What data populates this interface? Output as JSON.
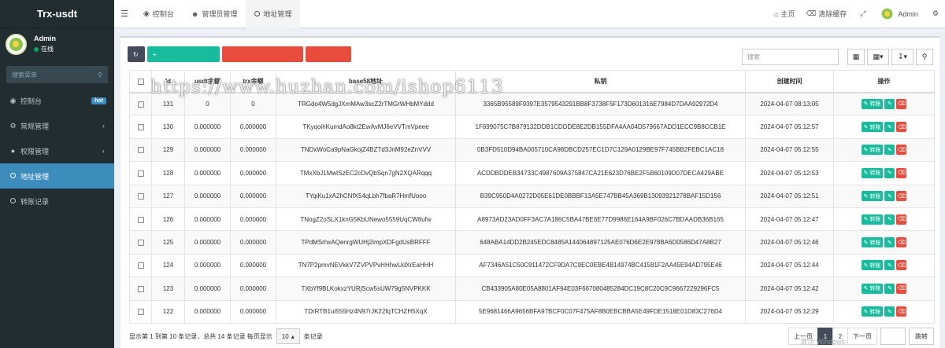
{
  "app": {
    "title": "Trx-usdt"
  },
  "user": {
    "name": "Admin",
    "status": "在线"
  },
  "sidebar": {
    "search_placeholder": "搜索菜单",
    "items": [
      {
        "label": "控制台",
        "icon": "dashboard-icon",
        "badge": "hot"
      },
      {
        "label": "常规管理",
        "icon": "cogs-icon"
      },
      {
        "label": "权限管理",
        "icon": "users-icon"
      },
      {
        "label": "地址管理",
        "icon": "circle-icon",
        "active": true
      },
      {
        "label": "转账记录",
        "icon": "circle-icon"
      }
    ]
  },
  "topbar": {
    "tabs": [
      {
        "label": "控制台",
        "icon": "dashboard-icon"
      },
      {
        "label": "管理员管理",
        "icon": "user-icon"
      },
      {
        "label": "地址管理",
        "icon": "circle-icon",
        "active": true
      }
    ],
    "home_label": "主页",
    "clear_cache_label": "清除缓存",
    "user_label": "Admin"
  },
  "toolbar": {
    "watermark": "https://www.huzhan.com/ishop6113",
    "search_placeholder": "搜索"
  },
  "table": {
    "headers": [
      "Id",
      "usdt余额",
      "trx余额",
      "base58地址",
      "私钥",
      "创建时间",
      "操作"
    ],
    "transfer_label": "转账",
    "rows": [
      {
        "id": "131",
        "usdt": "0",
        "trx": "0",
        "addr": "TRGdo4W5dgJXmMAw3scZ2rTMGrWHbMYddd",
        "key": "3365B95589F9397E3579543291BB8F3738F5F173D601316E7984D7DAA92972D4",
        "time": "2024-04-07 08:13:05"
      },
      {
        "id": "130",
        "usdt": "0.000000",
        "trx": "0.000000",
        "addr": "TKyqoihKumdAo8kt2EwAvMJ6eVVTmVpeee",
        "key": "1F699075C7B879132DDB1CDDDE8E2DB155DFA4AA04D579667ADD1ECC9B8CCB1E",
        "time": "2024-04-07 05:12:57"
      },
      {
        "id": "129",
        "usdt": "0.000000",
        "trx": "0.000000",
        "addr": "TNDxWoCa9pNaGkojZ4BZTd3JnM92eZnVVV",
        "key": "0B3FD510D94BA005710CA98DBCD257EC1D7C129A0129BE97F745BB2FEBC1AC18",
        "time": "2024-04-07 05:12:55"
      },
      {
        "id": "128",
        "usdt": "0.000000",
        "trx": "0.000000",
        "addr": "TMxXbJ1MwtSzEC2cDvQbSqn7gN2XQARqqq",
        "key": "ACDDBDDEB34733C4987609A375847CA21E623D76BE2F5B60109D07DECA429ABE",
        "time": "2024-04-07 05:12:53"
      },
      {
        "id": "127",
        "usdt": "0.000000",
        "trx": "0.000000",
        "addr": "TYqiKu1xA2hCNfX54qLbh7fbaR7HmfUooo",
        "key": "B39C950D4A0272D05E61DE0BBBF13A5E747BB45A369B13093921278BAF15D156",
        "time": "2024-04-07 05:12:51"
      },
      {
        "id": "126",
        "usdt": "0.000000",
        "trx": "0.000000",
        "addr": "TNogZ2oSLX1knG5KbUNewo5559UqCW8ufw",
        "key": "A8973AD23AD0FF3AC7A186C5BA47BE6E77D9986E164A9BF026C7BDAADB36B165",
        "time": "2024-04-07 05:12:47"
      },
      {
        "id": "125",
        "usdt": "0.000000",
        "trx": "0.000000",
        "addr": "TPdMSrhxAQenrgWUHj2impXDFgdUsBRFFF",
        "key": "648ABA14DD2B245EDC8485A144064897125AE076D6E2E978BA6D0586D47A8B27",
        "time": "2024-04-07 05:12:46"
      },
      {
        "id": "124",
        "usdt": "0.000000",
        "trx": "0.000000",
        "addr": "TN7P2pmvNEVkkV7ZVPVPvHHhwUdXrEaHHH",
        "key": "AF7346A51C50C911472CF9DA7C9EC0EBE4B14974BC41581F2AA45E94AD795E46",
        "time": "2024-04-07 05:12:44"
      },
      {
        "id": "123",
        "usdt": "0.000000",
        "trx": "0.000000",
        "addr": "TXbYf9BLKokxzYURjScw5sUW79g5NVPKKK",
        "key": "CB433905A80E05A8801AF94E03F667080485284DC19C8C20C9C9667229296FC5",
        "time": "2024-04-07 05:12:42"
      },
      {
        "id": "122",
        "usdt": "0.000000",
        "trx": "0.000000",
        "addr": "TDrRTB1ui555Hz4N97rJK22fqTCHZH5XqX",
        "key": "5E9681466A9656BFA97BCF0C07F475AF8B0EBCBBA5E49FDE1518E01D83C276D4",
        "time": "2024-04-07 05:12:29"
      }
    ]
  },
  "footer": {
    "summary": "显示第 1 到第 10 条记录，总共 14 条记录 每页显示",
    "page_size": "10",
    "page_size_suffix": "条记录",
    "prev": "上一页",
    "pages": [
      "1",
      "2"
    ],
    "next": "下一页",
    "go": "跳转"
  },
  "os_watermark": "激活 Windows"
}
